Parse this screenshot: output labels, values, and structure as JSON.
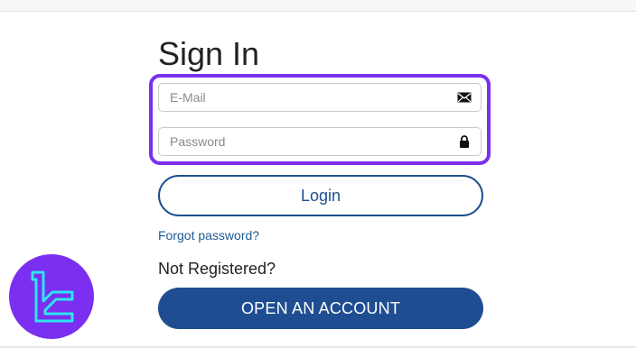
{
  "title": "Sign In",
  "form": {
    "email_placeholder": "E-Mail",
    "email_icon": "envelope-icon",
    "password_placeholder": "Password",
    "password_icon": "lock-icon",
    "highlight_color": "#7b2ff0"
  },
  "actions": {
    "login_label": "Login",
    "forgot_label": "Forgot password?",
    "not_registered_label": "Not Registered?",
    "open_account_label": "OPEN AN ACCOUNT"
  },
  "colors": {
    "primary": "#1f4d92",
    "link": "#1c5c96",
    "logo_bg": "#7b2ff0",
    "logo_mark": "#2ee6f0"
  }
}
